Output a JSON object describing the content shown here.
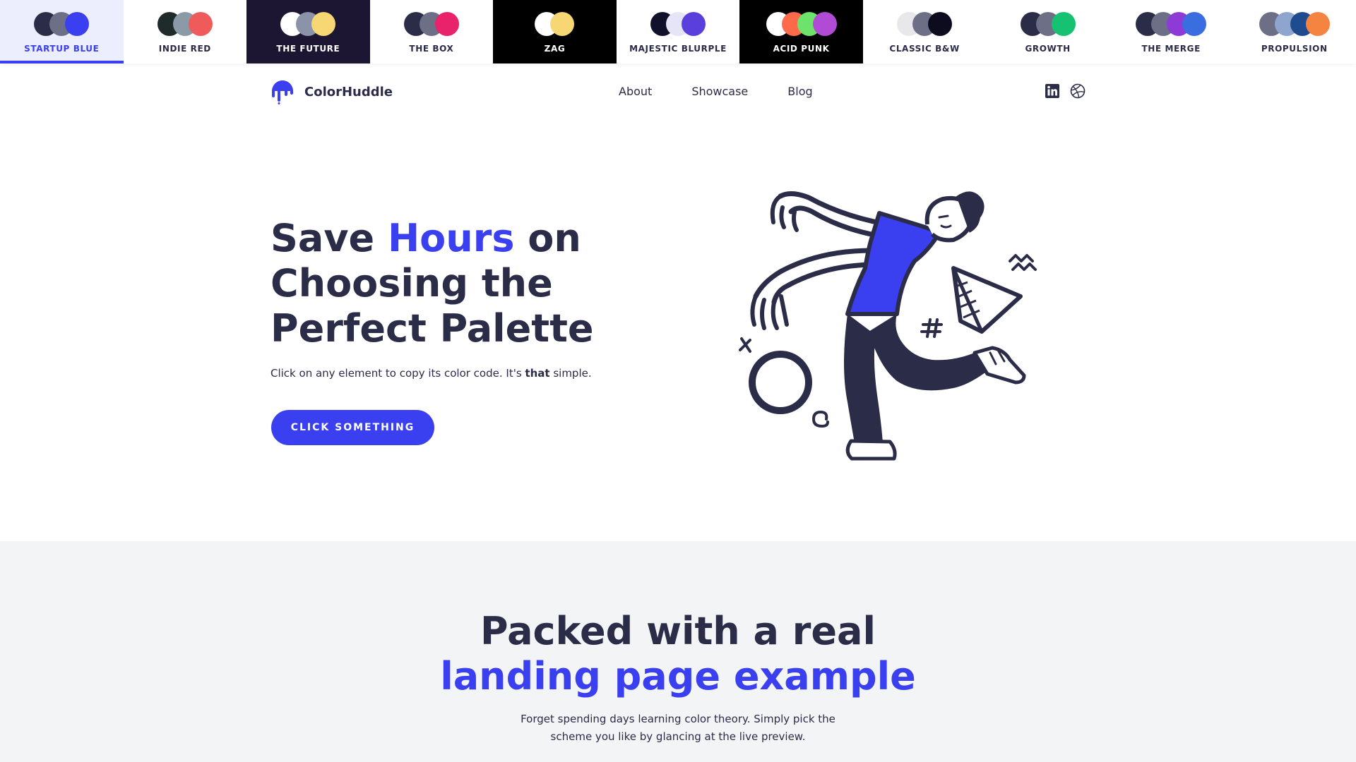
{
  "palettes": [
    {
      "name": "STARTUP BLUE",
      "bg": "#eceefd",
      "text": "#3a3ff0",
      "active": true,
      "colors": [
        "#2b2c48",
        "#6c6f86",
        "#3a3ff0"
      ]
    },
    {
      "name": "INDIE RED",
      "bg": "#ffffff",
      "text": "#2b2c48",
      "active": false,
      "colors": [
        "#1f2b2b",
        "#8b9aa6",
        "#ef5b5b"
      ]
    },
    {
      "name": "THE FUTURE",
      "bg": "#1d1633",
      "text": "#ffffff",
      "active": false,
      "colors": [
        "#ffffff",
        "#8b93a8",
        "#f7d774"
      ]
    },
    {
      "name": "THE BOX",
      "bg": "#ffffff",
      "text": "#2b2c48",
      "active": false,
      "colors": [
        "#2b2c48",
        "#6c6f86",
        "#e8236b"
      ]
    },
    {
      "name": "ZAG",
      "bg": "#000000",
      "text": "#ffffff",
      "active": false,
      "colors": [
        "#ffffff",
        "#f7d774"
      ]
    },
    {
      "name": "MAJESTIC BLURPLE",
      "bg": "#ffffff",
      "text": "#2b2c48",
      "active": false,
      "colors": [
        "#12112b",
        "#e6e4f7",
        "#5a3fdd"
      ]
    },
    {
      "name": "ACID PUNK",
      "bg": "#000000",
      "text": "#ffffff",
      "active": false,
      "colors": [
        "#ffffff",
        "#ff6b4a",
        "#6de36b",
        "#b14bd6"
      ]
    },
    {
      "name": "CLASSIC B&W",
      "bg": "#ffffff",
      "text": "#2b2c48",
      "active": false,
      "colors": [
        "#e8e8ea",
        "#6c6f86",
        "#0c0c1e"
      ]
    },
    {
      "name": "GROWTH",
      "bg": "#ffffff",
      "text": "#2b2c48",
      "active": false,
      "colors": [
        "#2b2c48",
        "#6c6f86",
        "#16c172"
      ]
    },
    {
      "name": "THE MERGE",
      "bg": "#ffffff",
      "text": "#2b2c48",
      "active": false,
      "colors": [
        "#2b2c48",
        "#6c6f86",
        "#8e3ad6",
        "#3a6ee0"
      ]
    },
    {
      "name": "PROPULSION",
      "bg": "#ffffff",
      "text": "#2b2c48",
      "active": false,
      "colors": [
        "#6c6f86",
        "#8ea5cf",
        "#1f4b8f",
        "#f58440"
      ]
    }
  ],
  "nav": {
    "brand": "ColorHuddle",
    "links": [
      "About",
      "Showcase",
      "Blog"
    ],
    "social": [
      "linkedin-icon",
      "dribbble-icon"
    ]
  },
  "hero": {
    "title_part1": "Save ",
    "title_accent": "Hours",
    "title_part2": " on Choosing the Perfect Palette",
    "subtitle_pre": "Click on any element to copy its color code. It's ",
    "subtitle_bold": "that",
    "subtitle_post": " simple.",
    "cta_label": "CLICK SOMETHING"
  },
  "section2": {
    "title_line1": "Packed with a real",
    "title_line2": "landing page example",
    "sub_line1": "Forget spending days learning color theory. Simply pick the",
    "sub_line2": "scheme you like by glancing at the live preview."
  },
  "colors": {
    "primary": "#3a3ff0",
    "dark": "#2b2c48",
    "section_bg": "#f3f4f6"
  }
}
